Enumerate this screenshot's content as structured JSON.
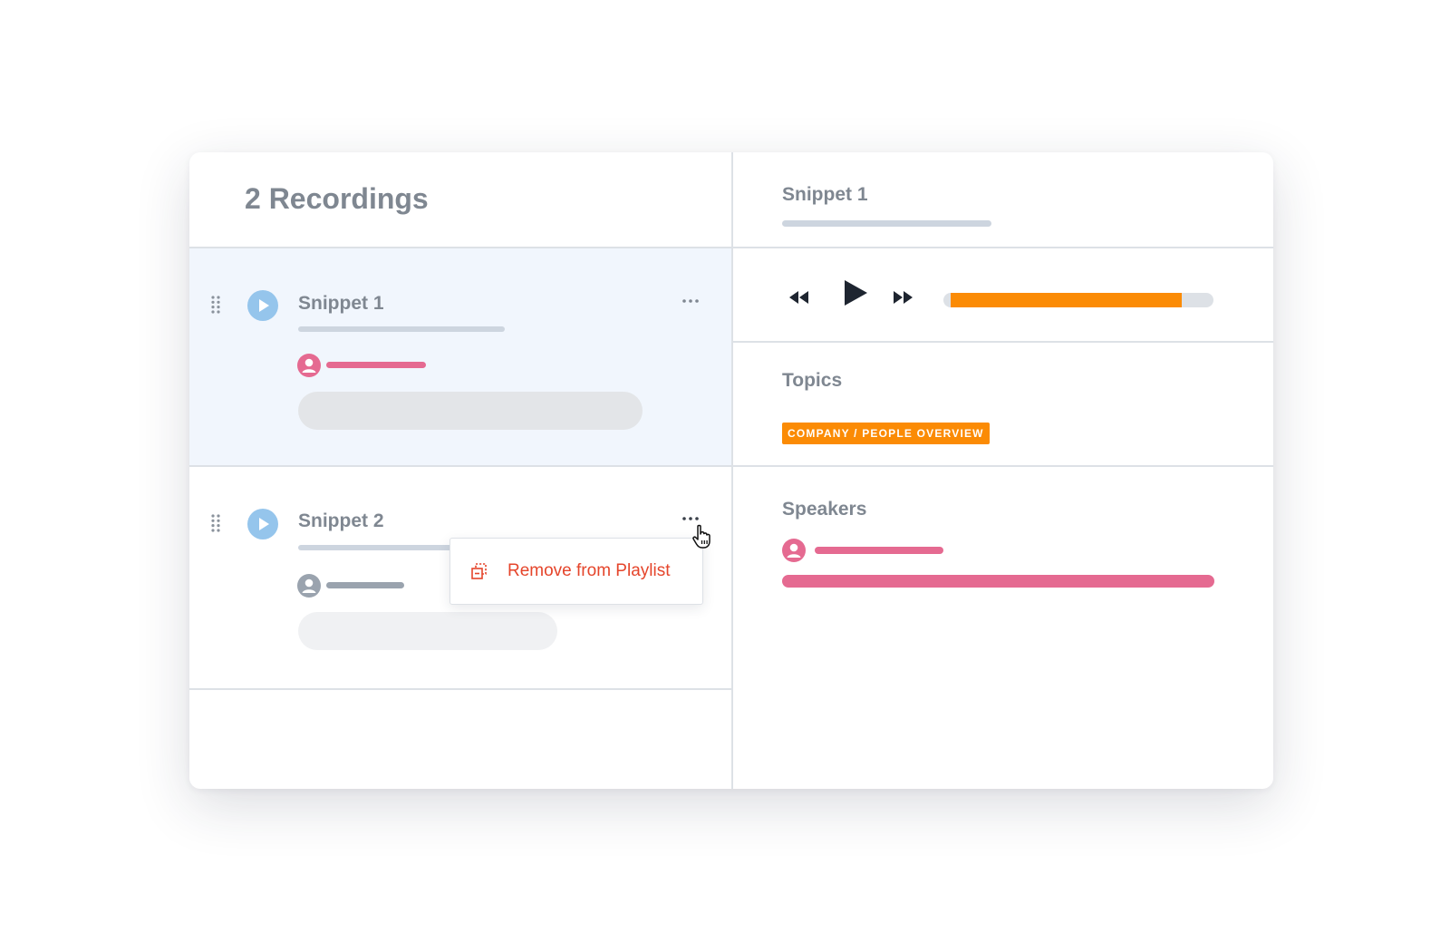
{
  "colors": {
    "accent_orange": "#fb8b05",
    "speaker_pink": "#e56a91",
    "play_blue": "#95c5ec",
    "danger_red": "#e5452b",
    "text_gray": "#7f8791",
    "placeholder_gray": "#cdd5df",
    "selected_row_bg": "#f1f6fd"
  },
  "list": {
    "title": "2 Recordings",
    "items": [
      {
        "title": "Snippet 1",
        "selected": true,
        "speaker_color": "pink",
        "icons": [
          "drag-handle-icon",
          "play-icon",
          "more-options-icon",
          "user-icon"
        ]
      },
      {
        "title": "Snippet 2",
        "selected": false,
        "speaker_color": "gray",
        "icons": [
          "drag-handle-icon",
          "play-icon",
          "more-options-icon",
          "user-icon"
        ]
      }
    ]
  },
  "context_menu": {
    "items": [
      {
        "label": "Remove from Playlist",
        "icon": "remove-from-playlist-icon"
      }
    ]
  },
  "detail": {
    "title": "Snippet 1",
    "player": {
      "controls": [
        "rewind-icon",
        "play-icon",
        "fast-forward-icon"
      ],
      "progress_percent": 88
    },
    "topics": {
      "label": "Topics",
      "tags": [
        "COMPANY / PEOPLE OVERVIEW"
      ]
    },
    "speakers": {
      "label": "Speakers"
    }
  }
}
